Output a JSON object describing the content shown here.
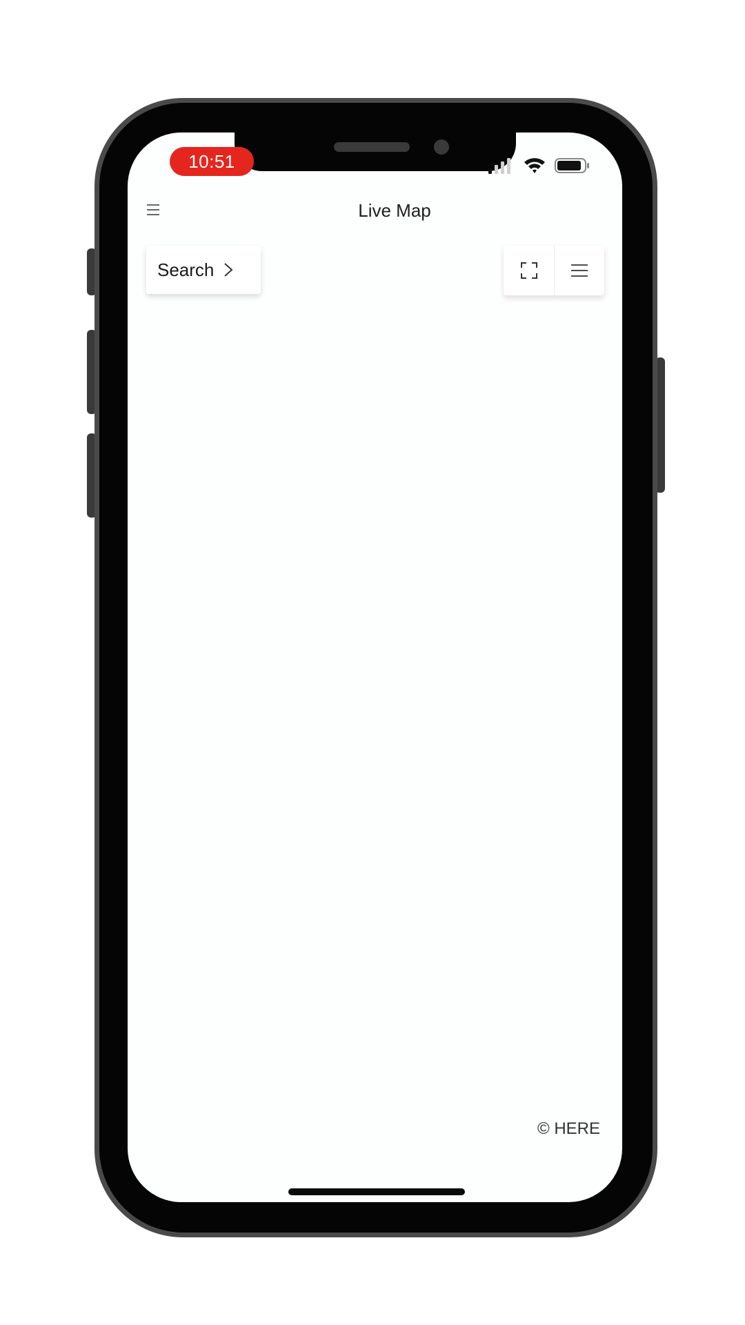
{
  "status_bar": {
    "time": "10:51",
    "time_pill_color": "#e5261e",
    "icons": [
      "signal-icon",
      "wifi-icon",
      "battery-icon"
    ]
  },
  "header": {
    "title": "Live Map",
    "menu_icon": "hamburger-menu-icon"
  },
  "map_controls": {
    "search_label": "Search",
    "search_icon": "chevron-right-icon",
    "fullscreen_icon": "fullscreen-icon",
    "layers_menu_icon": "list-menu-icon"
  },
  "map": {
    "copyright": "© HERE"
  }
}
